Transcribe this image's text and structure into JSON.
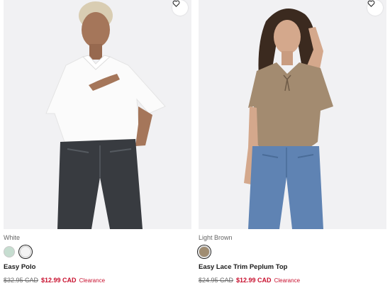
{
  "products": [
    {
      "color_name": "White",
      "swatches": [
        {
          "name": "mint",
          "color": "#c6ddd0",
          "selected": false
        },
        {
          "name": "white",
          "color": "#f4f4f4",
          "selected": true
        }
      ],
      "name": "Easy Polo",
      "old_price": "$32.95 CAD",
      "sale_price": "$12.99 CAD",
      "badge": "Clearance",
      "wishlist_icon": "heart-outline-icon"
    },
    {
      "color_name": "Light Brown",
      "swatches": [
        {
          "name": "light-brown",
          "color": "#a08d72",
          "selected": true
        }
      ],
      "name": "Easy Lace Trim Peplum Top",
      "old_price": "$24.95 CAD",
      "sale_price": "$12.99 CAD",
      "badge": "Clearance",
      "wishlist_icon": "heart-outline-icon"
    }
  ],
  "colors": {
    "sale_red": "#c8102e",
    "photo_background": "#f1f1f3"
  }
}
